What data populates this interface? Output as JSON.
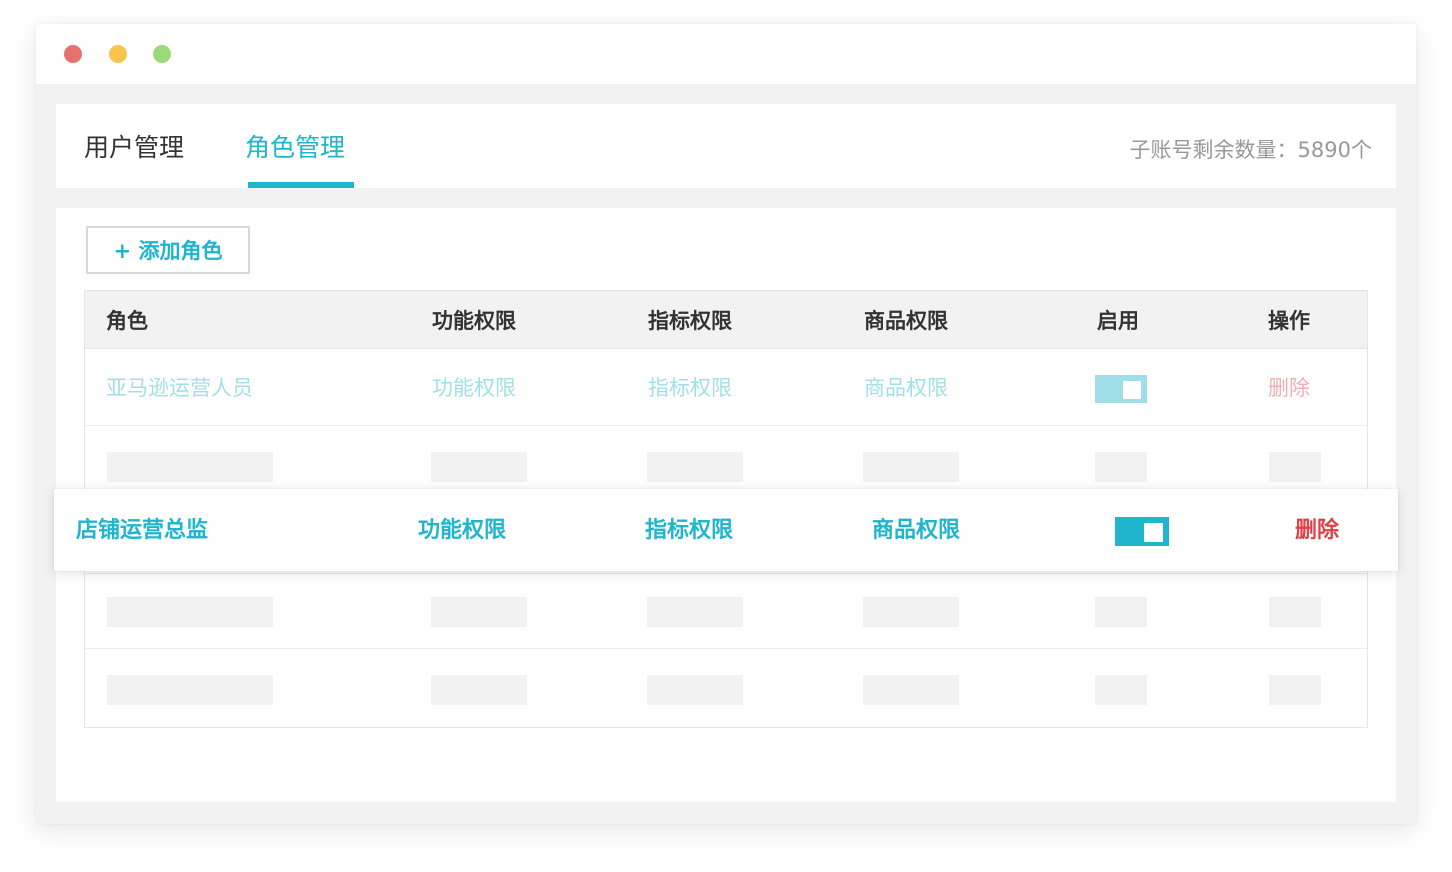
{
  "colors": {
    "accent": "#1fb5cc",
    "danger": "#e0404a",
    "dot_red": "#e8716d",
    "dot_yellow": "#f7c54a",
    "dot_green": "#9bd97a"
  },
  "window": {
    "controls": [
      "close",
      "minimize",
      "maximize"
    ]
  },
  "tabs": [
    {
      "label": "用户管理",
      "active": false
    },
    {
      "label": "角色管理",
      "active": true
    }
  ],
  "quota_text": "子账号剩余数量：5890个",
  "add_button_label": "+ 添加角色",
  "table": {
    "headers": [
      "角色",
      "功能权限",
      "指标权限",
      "商品权限",
      "启用",
      "操作"
    ],
    "rows": [
      {
        "role": "亚马逊运营人员",
        "func": "功能权限",
        "metric": "指标权限",
        "product": "商品权限",
        "enabled": true,
        "action": "删除"
      }
    ]
  },
  "highlighted_row": {
    "role": "店铺运营总监",
    "func": "功能权限",
    "metric": "指标权限",
    "product": "商品权限",
    "enabled": true,
    "action": "删除"
  }
}
